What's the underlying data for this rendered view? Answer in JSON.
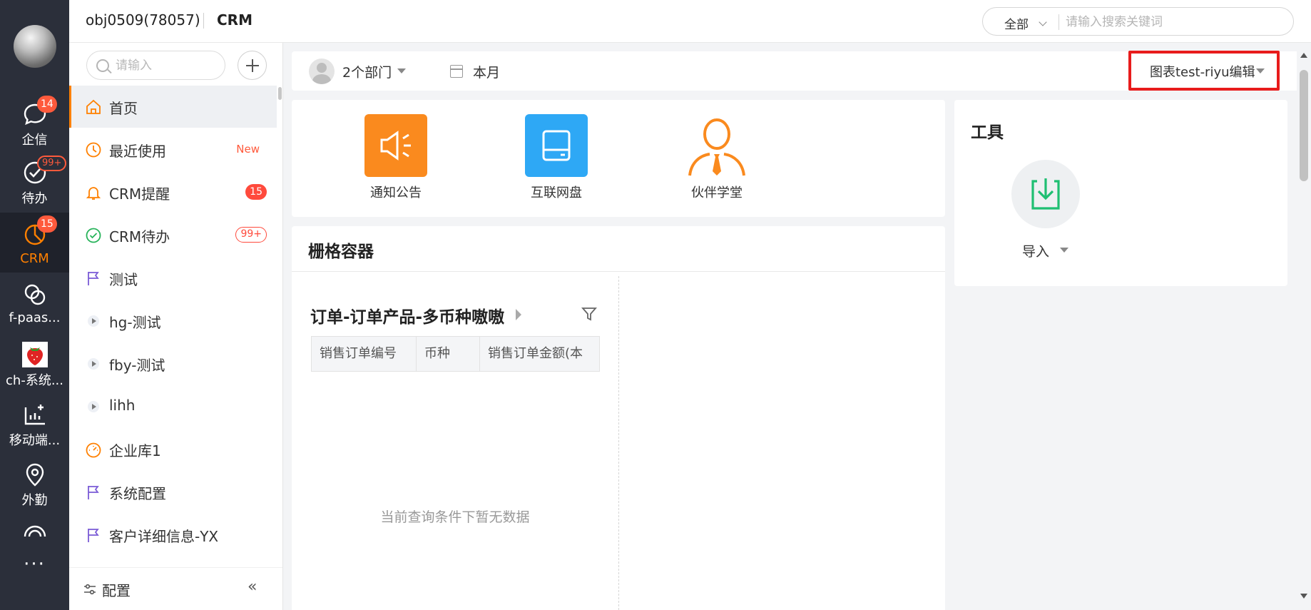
{
  "rail": {
    "items": [
      {
        "label": "企信",
        "badge": "14"
      },
      {
        "label": "待办",
        "badge": "99+"
      },
      {
        "label": "CRM",
        "badge": "15"
      },
      {
        "label": "f-paas..."
      },
      {
        "label": "ch-系统..."
      },
      {
        "label": "移动端..."
      },
      {
        "label": "外勤"
      }
    ],
    "more": "···"
  },
  "header": {
    "tenant": "obj0509(78057)",
    "app": "CRM",
    "search_scope": "全部",
    "search_placeholder": "请输入搜索关键词"
  },
  "menu": {
    "search_placeholder": "请输入",
    "items": [
      {
        "label": "首页"
      },
      {
        "label": "最近使用",
        "tag": "New"
      },
      {
        "label": "CRM提醒",
        "badge": "15"
      },
      {
        "label": "CRM待办",
        "badge": "99+"
      },
      {
        "label": "测试"
      },
      {
        "label": "hg-测试"
      },
      {
        "label": "fby-测试"
      },
      {
        "label": "lihh"
      },
      {
        "label": "企业库1"
      },
      {
        "label": "系统配置"
      },
      {
        "label": "客户详细信息-YX"
      }
    ],
    "footer_label": "配置",
    "collapse_glyph": "«"
  },
  "filter": {
    "dept": "2个部门",
    "period": "本月",
    "edit_label": "图表test-riyu编辑"
  },
  "apps": [
    {
      "label": "通知公告",
      "color": "#fa8a1e"
    },
    {
      "label": "互联网盘",
      "color": "#2ea8f5"
    },
    {
      "label": "伙伴学堂",
      "color": "#fa8a1e"
    }
  ],
  "tools": {
    "title": "工具",
    "import_label": "导入"
  },
  "grid": {
    "title": "栅格容器",
    "report_title": "订单-订单产品-多币种嗷嗷",
    "columns": [
      "销售订单编号",
      "币种",
      "销售订单金额(本"
    ],
    "empty_text": "当前查询条件下暂无数据"
  },
  "colors": {
    "accent": "#ff8000",
    "badge": "#ff5a3c",
    "highlight": "#e81c1c"
  }
}
